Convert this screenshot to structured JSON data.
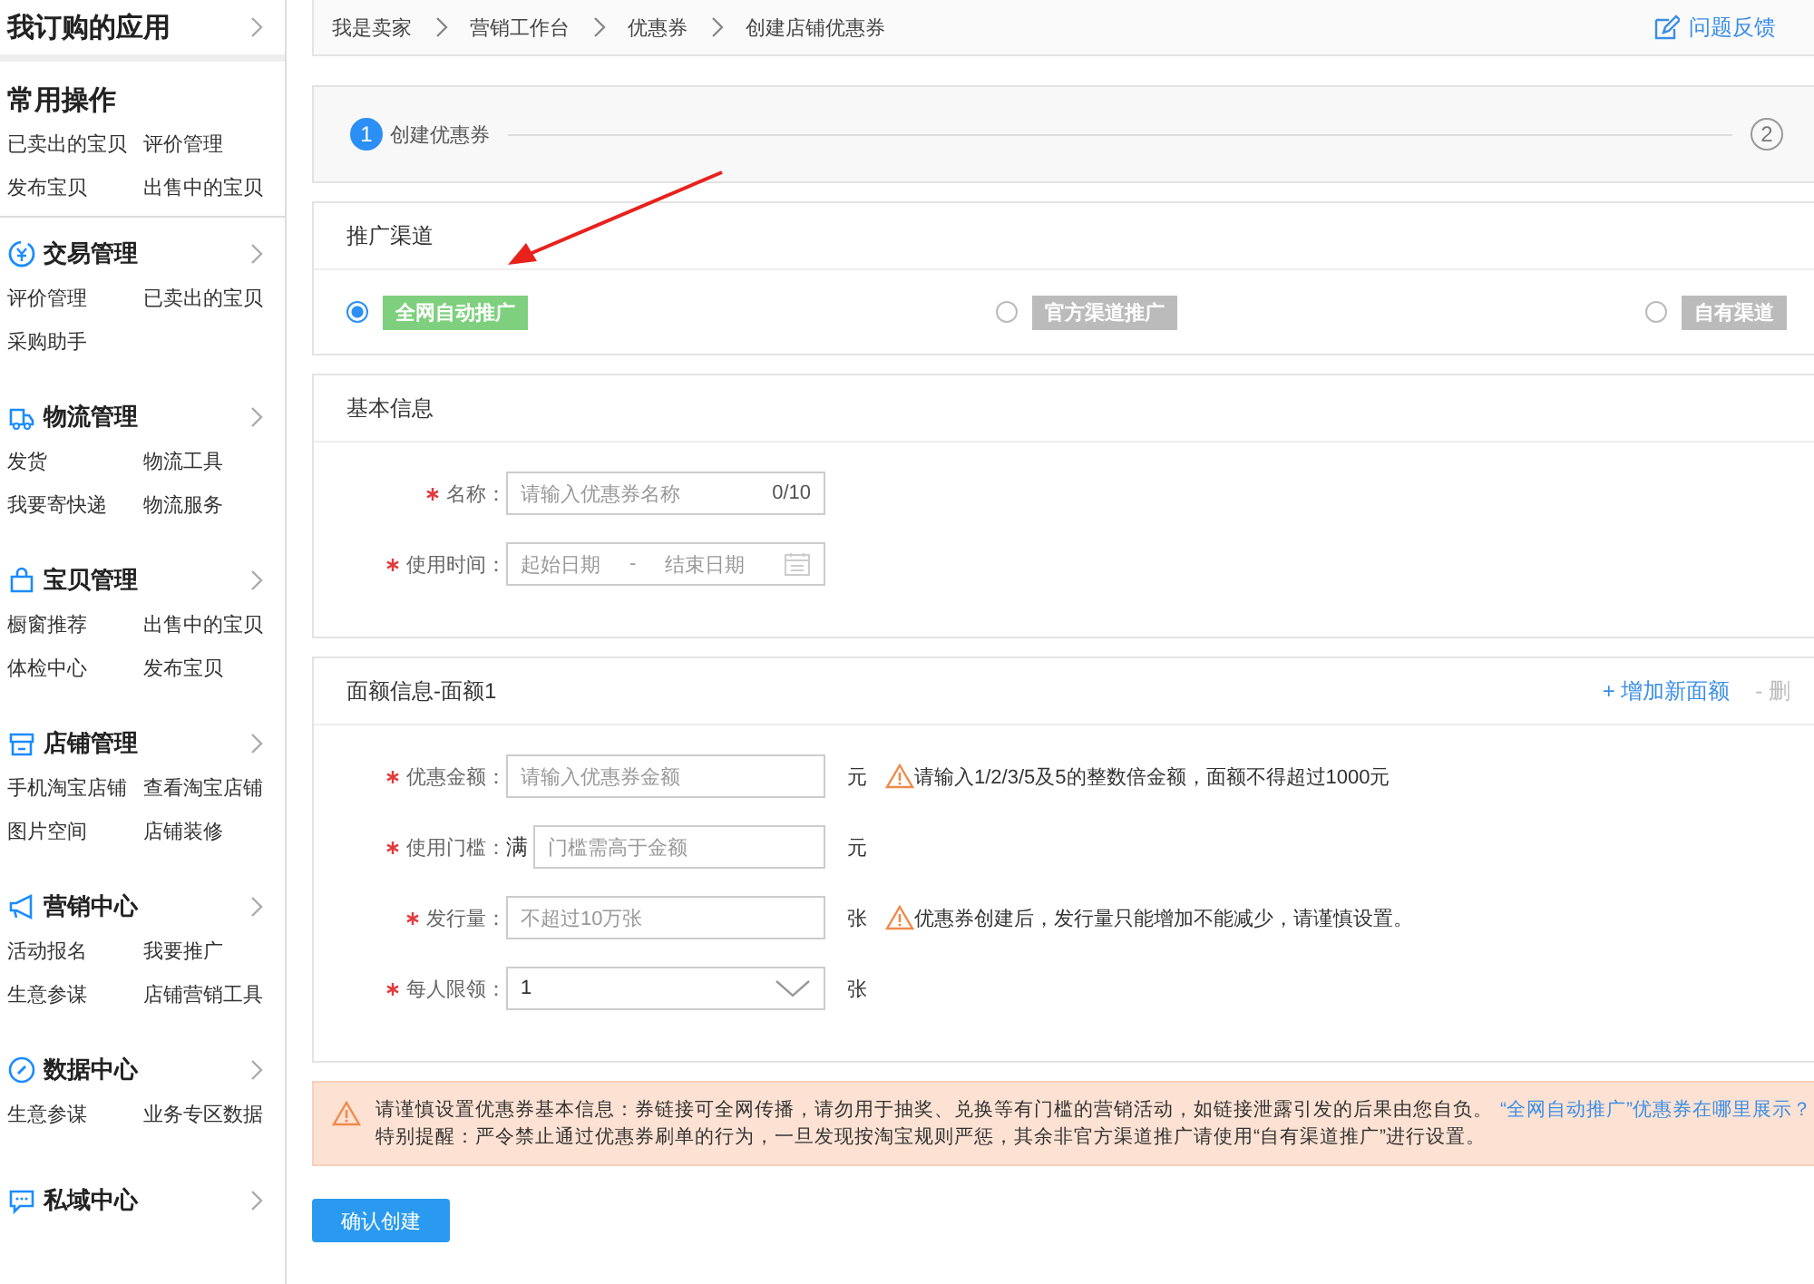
{
  "sidebar": {
    "subscribed": {
      "title": "我订购的应用"
    },
    "common": {
      "title": "常用操作",
      "links": [
        "已卖出的宝贝",
        "评价管理",
        "发布宝贝",
        "出售中的宝贝"
      ]
    },
    "sections": [
      {
        "kind": "yen",
        "title": "交易管理",
        "links": [
          "评价管理",
          "已卖出的宝贝",
          "采购助手"
        ]
      },
      {
        "kind": "truck",
        "title": "物流管理",
        "links": [
          "发货",
          "物流工具",
          "我要寄快递",
          "物流服务"
        ]
      },
      {
        "kind": "bag",
        "title": "宝贝管理",
        "links": [
          "橱窗推荐",
          "出售中的宝贝",
          "体检中心",
          "发布宝贝"
        ]
      },
      {
        "kind": "store",
        "title": "店铺管理",
        "links": [
          "手机淘宝店铺",
          "查看淘宝店铺",
          "图片空间",
          "店铺装修"
        ]
      },
      {
        "kind": "megaphone",
        "title": "营销中心",
        "links": [
          "活动报名",
          "我要推广",
          "生意参谋",
          "店铺营销工具"
        ]
      },
      {
        "kind": "compass",
        "title": "数据中心",
        "links": [
          "生意参谋",
          "业务专区数据"
        ]
      },
      {
        "kind": "chat",
        "title": "私域中心"
      }
    ]
  },
  "breadcrumb": [
    "我是卖家",
    "营销工作台",
    "优惠券",
    "创建店铺优惠券"
  ],
  "feedback": "问题反馈",
  "steps": [
    {
      "number": "1",
      "label": "创建优惠券",
      "selected": true
    },
    {
      "number": "2",
      "selected": false
    }
  ],
  "channel": {
    "title": "推广渠道",
    "options": [
      {
        "label": "全网自动推广",
        "selected": true
      },
      {
        "label": "官方渠道推广",
        "selected": false
      },
      {
        "label": "自有渠道",
        "selected": false
      }
    ]
  },
  "basic": {
    "title": "基本信息",
    "fields": [
      {
        "kind": "text",
        "label": "名称：",
        "required": true,
        "placeholder": "请输入优惠券名称",
        "counter": "0/10"
      },
      {
        "kind": "daterange",
        "label": "使用时间：",
        "required": true,
        "start": "起始日期",
        "separator": "-",
        "end": "结束日期"
      }
    ]
  },
  "denomination": {
    "title": "面额信息-面额1",
    "add": "+ 增加新面额",
    "remove": "- 删",
    "fields": [
      {
        "kind": "text",
        "label": "优惠金额：",
        "required": true,
        "placeholder": "请输入优惠券金额",
        "unit": "元",
        "hint": "请输入1/2/3/5及5的整数倍金额，面额不得超过1000元"
      },
      {
        "kind": "text",
        "label": "使用门槛：",
        "required": true,
        "prefix": "满",
        "placeholder": "门槛需高于金额",
        "unit": "元"
      },
      {
        "kind": "text",
        "label": "发行量：",
        "required": true,
        "placeholder": "不超过10万张",
        "unit": "张",
        "hint": "优惠券创建后，发行量只能增加不能减少，请谨慎设置。"
      },
      {
        "kind": "select",
        "label": "每人限领：",
        "required": true,
        "value": "1",
        "unit": "张"
      }
    ]
  },
  "notice": {
    "line1": "请谨慎设置优惠券基本信息：券链接可全网传播，请勿用于抽奖、兑换等有门槛的营销活动，如链接泄露引发的后果由您自负。",
    "link": "“全网自动推广”优惠券在哪里展示？",
    "line2": "特别提醒：严令禁止通过优惠券刷单的行为，一旦发现按淘宝规则严惩，其余非官方渠道推广请使用“自有渠道推广”进行设置。"
  },
  "submit": "确认创建"
}
